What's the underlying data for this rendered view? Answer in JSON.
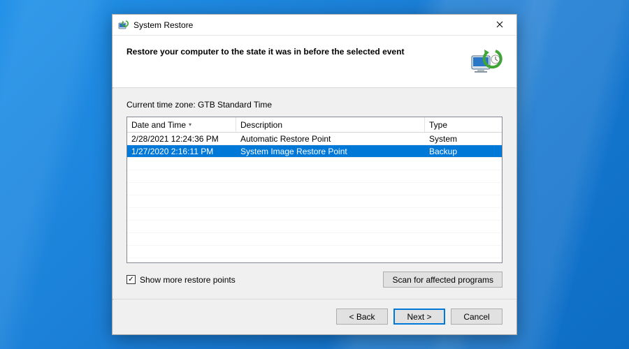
{
  "window": {
    "title": "System Restore"
  },
  "header": {
    "heading": "Restore your computer to the state it was in before the selected event"
  },
  "timezone": {
    "label": "Current time zone: GTB Standard Time"
  },
  "table": {
    "sort_column": 0,
    "columns": {
      "date": "Date and Time",
      "description": "Description",
      "type": "Type"
    },
    "rows": [
      {
        "date": "2/28/2021 12:24:36 PM",
        "description": "Automatic Restore Point",
        "type": "System",
        "selected": false
      },
      {
        "date": "1/27/2020 2:16:11 PM",
        "description": "System Image Restore Point",
        "type": "Backup",
        "selected": true
      }
    ]
  },
  "checkbox": {
    "checked": true,
    "label": "Show more restore points"
  },
  "buttons": {
    "scan": "Scan for affected programs",
    "back": "< Back",
    "next": "Next >",
    "cancel": "Cancel"
  }
}
